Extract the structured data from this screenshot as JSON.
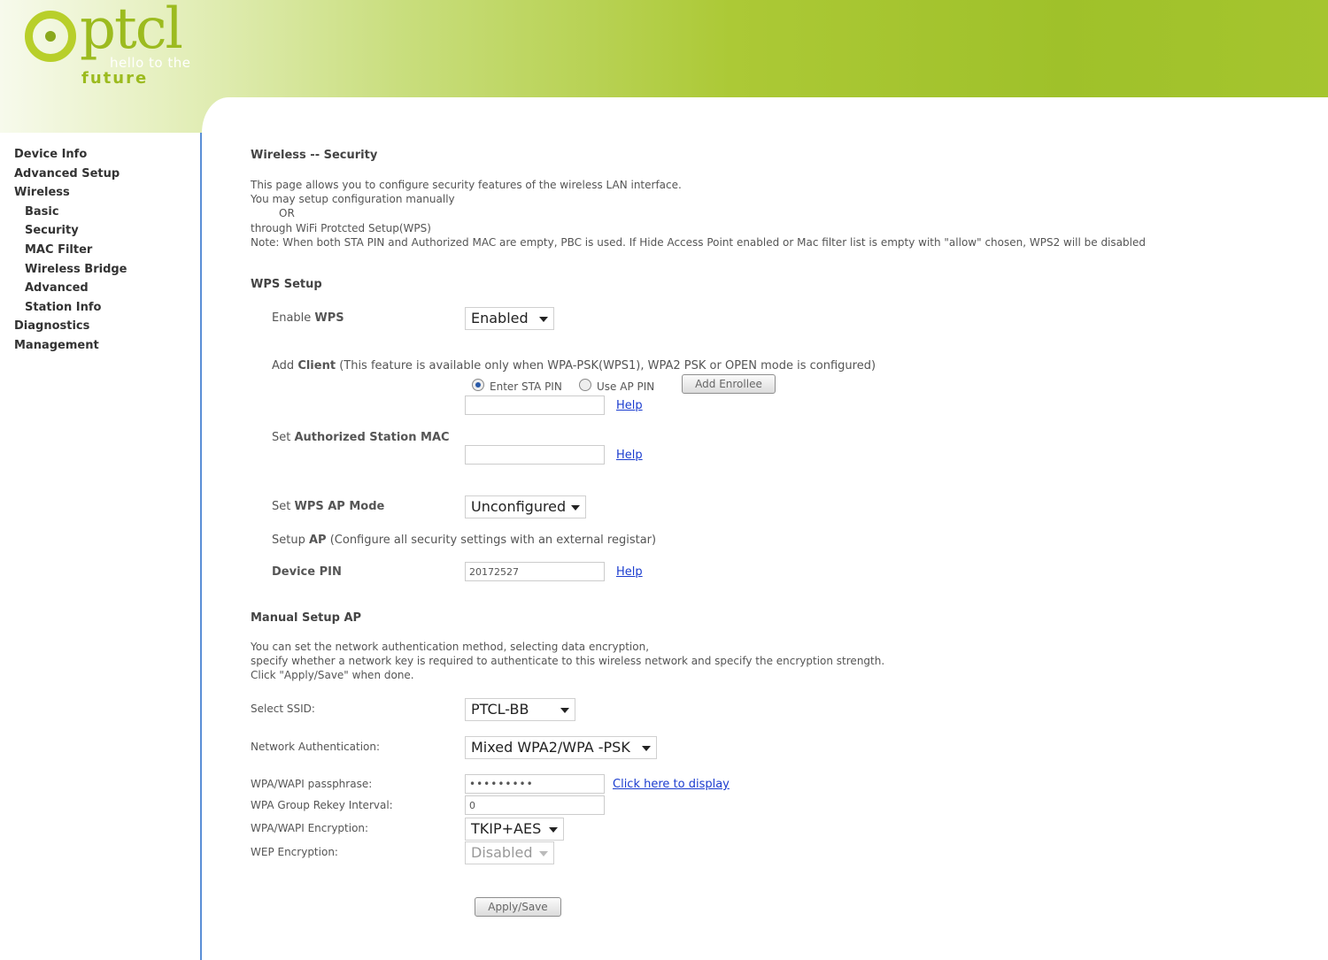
{
  "brand": {
    "logo_text": "ptcl",
    "tagline_1": "hello to the",
    "tagline_2": "future"
  },
  "sidebar": {
    "items": [
      {
        "label": "Device Info",
        "level": 1
      },
      {
        "label": "Advanced Setup",
        "level": 1
      },
      {
        "label": "Wireless",
        "level": 1
      },
      {
        "label": "Basic",
        "level": 2
      },
      {
        "label": "Security",
        "level": 2
      },
      {
        "label": "MAC Filter",
        "level": 2
      },
      {
        "label": "Wireless Bridge",
        "level": 2
      },
      {
        "label": "Advanced",
        "level": 2
      },
      {
        "label": "Station Info",
        "level": 2
      },
      {
        "label": "Diagnostics",
        "level": 1
      },
      {
        "label": "Management",
        "level": 1
      }
    ]
  },
  "page": {
    "title": "Wireless -- Security",
    "intro_1": "This page allows you to configure security features of the wireless LAN interface.",
    "intro_2": "You may setup configuration manually",
    "intro_or": "OR",
    "intro_3": "through WiFi Protcted Setup(WPS)",
    "intro_note": "Note: When both STA PIN and Authorized MAC are empty, PBC is used. If Hide Access Point enabled or Mac filter list is empty with \"allow\" chosen, WPS2 will be disabled"
  },
  "wps": {
    "section_title": "WPS Setup",
    "enable_label_pre": "Enable ",
    "enable_label_bold": "WPS",
    "enable_value": "Enabled",
    "add_client_pre": "Add ",
    "add_client_bold": "Client",
    "add_client_note": " (This feature is available only when WPA-PSK(WPS1), WPA2 PSK or OPEN mode is configured)",
    "radio_sta_pin": "Enter STA PIN",
    "radio_ap_pin": "Use AP PIN",
    "add_enrollee_label": "Add Enrollee",
    "sta_pin_value": "",
    "help_label": "Help",
    "auth_mac_pre": "Set ",
    "auth_mac_bold": "Authorized Station MAC",
    "auth_mac_value": "",
    "ap_mode_pre": "Set ",
    "ap_mode_bold": "WPS AP Mode",
    "ap_mode_value": "Unconfigured",
    "setup_ap_pre": "Setup ",
    "setup_ap_bold": "AP",
    "setup_ap_note": " (Configure all security settings with an external registar)",
    "device_pin_label": "Device PIN",
    "device_pin_value": "20172527"
  },
  "manual": {
    "section_title": "Manual Setup AP",
    "desc_1": "You can set the network authentication method, selecting data encryption,",
    "desc_2": "specify whether a network key is required to authenticate to this wireless network and specify the encryption strength.",
    "desc_3": "Click \"Apply/Save\" when done.",
    "ssid_label": "Select SSID:",
    "ssid_value": "PTCL-BB",
    "auth_label": "Network Authentication:",
    "auth_value": "Mixed WPA2/WPA -PSK",
    "passphrase_label": "WPA/WAPI passphrase:",
    "passphrase_value": "•••••••••",
    "display_link": "Click here to display",
    "rekey_label": "WPA Group Rekey Interval:",
    "rekey_value": "0",
    "encryption_label": "WPA/WAPI Encryption:",
    "encryption_value": "TKIP+AES",
    "wep_label": "WEP Encryption:",
    "wep_value": "Disabled",
    "apply_label": "Apply/Save"
  }
}
